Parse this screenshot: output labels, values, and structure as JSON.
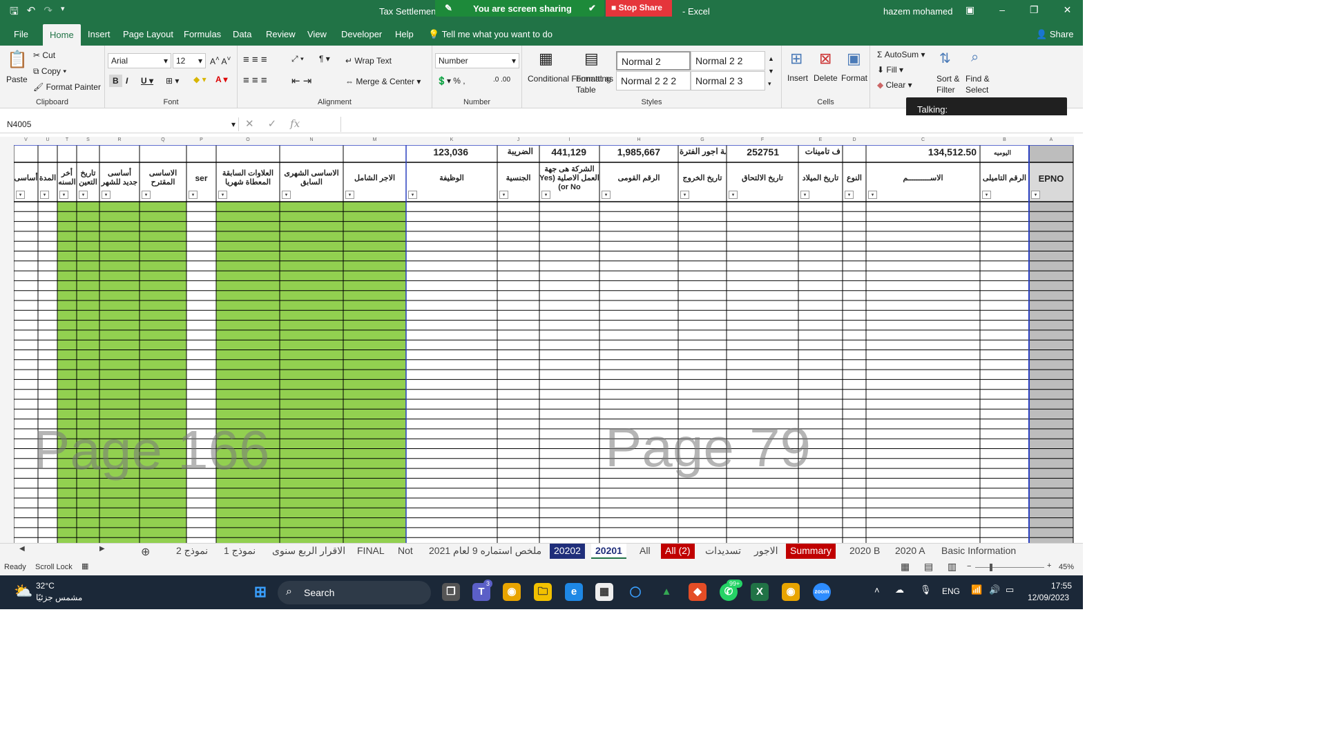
{
  "window": {
    "title": "Tax Settlement",
    "app": "Excel",
    "user": "hazem mohamed"
  },
  "share": {
    "text": "You are screen sharing",
    "stop": "Stop Share"
  },
  "tabs": [
    "File",
    "Home",
    "Insert",
    "Page Layout",
    "Formulas",
    "Data",
    "Review",
    "View",
    "Developer",
    "Help"
  ],
  "tell_me": "Tell me what you want to do",
  "share_btn": "Share",
  "ribbon": {
    "clipboard": {
      "paste": "Paste",
      "cut": "Cut",
      "copy": "Copy",
      "format_painter": "Format Painter",
      "label": "Clipboard"
    },
    "font": {
      "name": "Arial",
      "size": "12",
      "label": "Font"
    },
    "alignment": {
      "wrap": "Wrap Text",
      "merge": "Merge & Center",
      "label": "Alignment"
    },
    "number": {
      "format": "Number",
      "label": "Number"
    },
    "styles": {
      "cond": "Conditional Formatting",
      "table": "Format as Table",
      "s1": "Normal 2",
      "s2": "Normal 2 2",
      "s3": "Normal 2 2 2",
      "s4": "Normal 2 3",
      "label": "Styles"
    },
    "cells": {
      "insert": "Insert",
      "delete": "Delete",
      "format": "Format",
      "label": "Cells"
    },
    "editing": {
      "autosum": "AutoSum",
      "fill": "Fill",
      "clear": "Clear",
      "sort": "Sort & Filter",
      "find": "Find & Select"
    }
  },
  "talking": "Talking:",
  "namebox": "N4005",
  "columns": [
    "V",
    "U",
    "T",
    "S",
    "R",
    "Q",
    "P",
    "O",
    "N",
    "M",
    "K",
    "J",
    "I",
    "H",
    "G",
    "F",
    "E",
    "D",
    "C",
    "B",
    "A"
  ],
  "top_values": {
    "k": "123,036",
    "j": "الضريبة",
    "i": "441,129",
    "h": "1,985,667",
    "g": "مة اجور الفترة",
    "f": "252751",
    "e": "ف تامينات",
    "c": "134,512.50",
    "b": "اليوميه"
  },
  "headers": {
    "a": "EPNO",
    "b": "الرقم التاميلى",
    "c": "الاســــــــــم",
    "d": "النوع",
    "e": "تاريخ الميلاد",
    "f": "تاريخ الالتحاق",
    "g": "تاريخ الخروج",
    "h": "الرقم القومى",
    "i": "الشركة هى جهة العمل الاصلية (Yes or No)",
    "j": "الجنسية",
    "k": "الوظيفة",
    "m": "الاجر الشامل",
    "n": "الاساسى الشهرى السابق",
    "o": "العلاوات السابقة المعطاة شهريا",
    "p": "ser",
    "q": "الاساسى المقترح",
    "r": "أساسى جديد للشهر",
    "s": "تاريخ التعين",
    "t": "أخر السنه",
    "u": "المدة",
    "v": "أساسى"
  },
  "watermarks": {
    "left": "Page 166",
    "right": "Page 79"
  },
  "sheet_tabs": [
    "نموذج 2",
    "نموذج 1",
    "الاقرار الربع سنوى",
    "FINAL",
    "Not",
    "ملخص استماره 9 لعام 2021",
    "20202",
    "20201",
    "All",
    "All (2)",
    "تسديدات",
    "الاجور",
    "Summary",
    "2020 B",
    "2020 A",
    "Basic Information"
  ],
  "status": {
    "ready": "Ready",
    "scroll": "Scroll Lock",
    "zoom": "45%"
  },
  "taskbar": {
    "weather_temp": "32°C",
    "weather_desc": "مشمس جزئيًا",
    "search": "Search",
    "badge1": "3",
    "badge2": "99+",
    "lang": "ENG",
    "time": "17:55",
    "date": "12/09/2023"
  },
  "colors": {
    "excel_green": "#217346",
    "green_fill": "#92d050",
    "stop_red": "#e5353b"
  }
}
